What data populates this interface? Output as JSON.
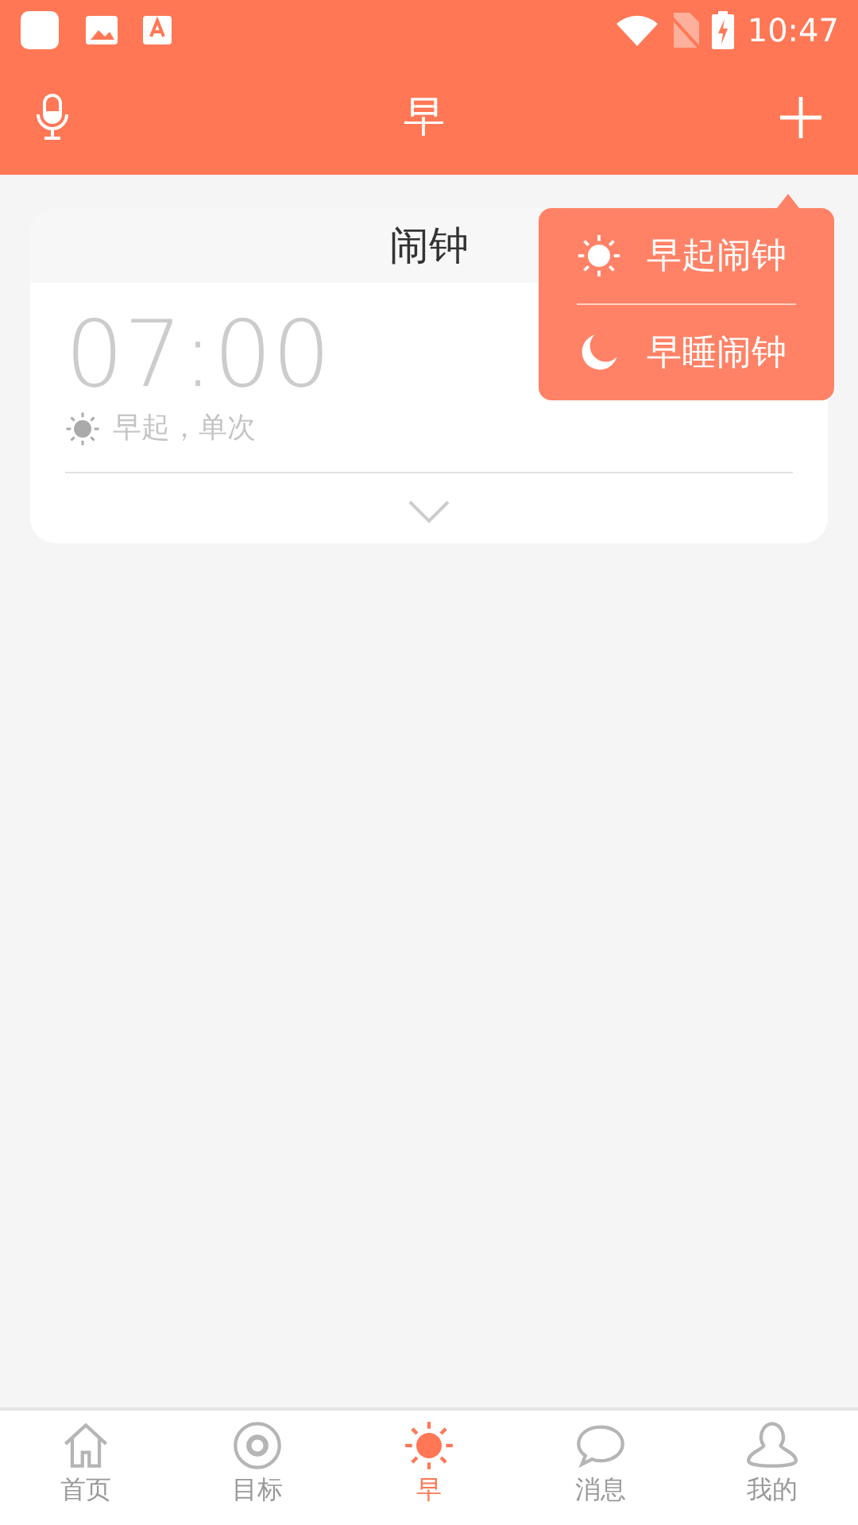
{
  "status_bar": {
    "time": "10:47"
  },
  "app_bar": {
    "title": "早"
  },
  "alarm_card": {
    "title": "闹钟",
    "time": "07:00",
    "detail": "早起，单次",
    "kind": "sun"
  },
  "menu": {
    "items": [
      {
        "kind": "sun",
        "label": "早起闹钟"
      },
      {
        "kind": "moon",
        "label": "早睡闹钟"
      }
    ]
  },
  "tabs": [
    {
      "kind": "home",
      "label": "首页",
      "selected": false
    },
    {
      "kind": "target",
      "label": "目标",
      "selected": false
    },
    {
      "kind": "sun",
      "label": "早",
      "selected": true
    },
    {
      "kind": "chat",
      "label": "消息",
      "selected": false
    },
    {
      "kind": "user",
      "label": "我的",
      "selected": false
    }
  ]
}
